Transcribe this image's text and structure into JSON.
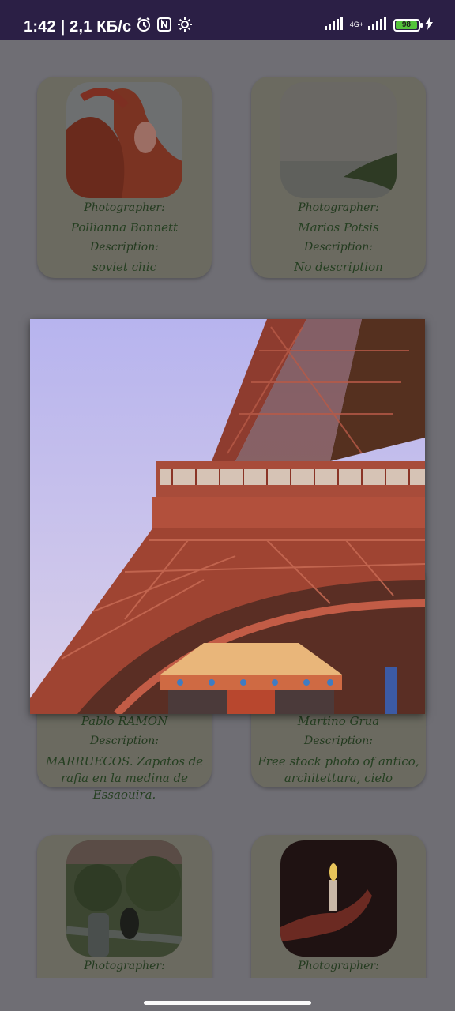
{
  "status": {
    "time_and_speed": "1:42 | 2,1 КБ/с",
    "net_top": "4G+",
    "battery": "98"
  },
  "labels": {
    "photographer": "Photographer:",
    "description": "Description:"
  },
  "cards": [
    {
      "photographer": "Pollianna Bonnett",
      "description": "soviet chic"
    },
    {
      "photographer": "Marios Potsis",
      "description": "No description"
    },
    {
      "photographer": "Pablo RAMON",
      "description": "MARRUECOS. Zapatos de rafia en la medina de Essaouira."
    },
    {
      "photographer": "Martino Grua",
      "description": "Free stock photo of antico, architettura, cielo"
    },
    {
      "photographer": "",
      "description": ""
    },
    {
      "photographer": "",
      "description": ""
    }
  ],
  "colors": {
    "status_bar": "#2b1f45",
    "scrim_background": "#6f6e74",
    "card": "#6b6a60",
    "text_green": "#253f21",
    "battery_green": "#54c43a"
  },
  "icons": [
    "alarm-icon",
    "nfc-icon",
    "settings-gear-icon",
    "signal-icon",
    "battery-icon",
    "charging-icon"
  ]
}
